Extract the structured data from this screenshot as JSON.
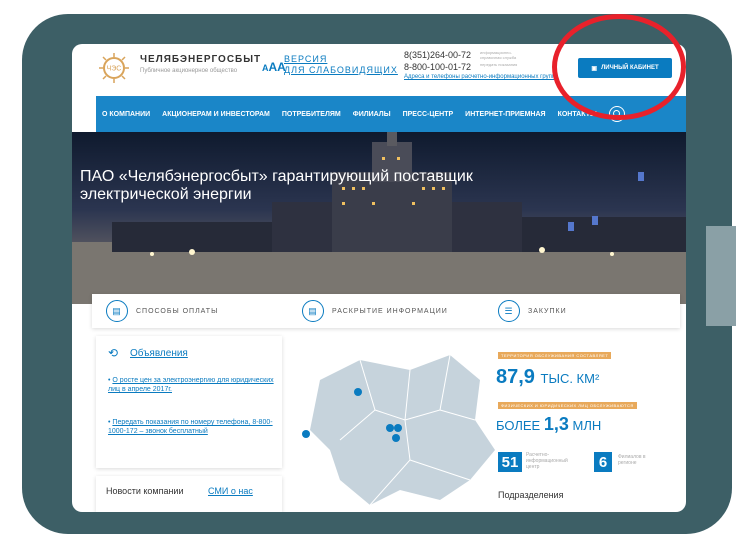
{
  "header": {
    "brand": "ЧЕЛЯБЭНЕРГОСБЫТ",
    "brand_sub": "Публичное акционерное общество",
    "logo_text": "ЧЭС",
    "font_size_toggle": "AA",
    "font_size_small": "A",
    "accessible_version": "ВЕРСИЯ",
    "accessible_version_2": "ДЛЯ СЛАБОВИДЯЩИХ",
    "phone_1": "8(351)264-00-72",
    "phone_1_note": "информационно-справочная служба",
    "phone_2": "8-800-100-01-72",
    "phone_2_note": "передать показания",
    "addresses_link": "Адреса и телефоны расчетно-информационных групп",
    "cabinet_button": "ЛИЧНЫЙ КАБИНЕТ"
  },
  "nav": {
    "items": [
      "О КОМПАНИИ",
      "АКЦИОНЕРАМ И ИНВЕСТОРАМ",
      "ПОТРЕБИТЕЛЯМ",
      "ФИЛИАЛЫ",
      "ПРЕСС-ЦЕНТР",
      "ИНТЕРНЕТ-ПРИЕМНАЯ",
      "КОНТАКТЫ"
    ]
  },
  "hero": {
    "title": "ПАО «Челябэнергосбыт» гарантирующий поставщик электрической энергии"
  },
  "quick_links": {
    "items": [
      "СПОСОБЫ ОПЛАТЫ",
      "РАСКРЫТИЕ ИНФОРМАЦИИ",
      "ЗАКУПКИ"
    ]
  },
  "announcements": {
    "title": "Объявления",
    "items": [
      "О росте цен за электроэнергию для юридических лиц в апреле 2017г.",
      "Передать показания по номеру телефона, 8-800-1000-172 – звонок бесплатный"
    ]
  },
  "news": {
    "company_news": "Новости компании",
    "media": "СМИ о нас"
  },
  "stats": {
    "territory_label": "ТЕРРИТОРИЯ ОБСЛУЖИВАНИЯ СОСТАВЛЯЕТ",
    "territory_value": "87,9",
    "territory_unit": "ТЫС. КМ²",
    "customers_label": "ФИЗИЧЕСКИХ И ЮРИДИЧЕСКИХ ЛИЦ ОБСЛУЖИВАЮТСЯ",
    "customers_prefix": "БОЛЕЕ",
    "customers_value": "1,3",
    "customers_unit": "МЛН",
    "centers_value": "51",
    "centers_label": "Расчетно-информационный центр",
    "branches_value": "6",
    "branches_label": "Филиалов в регионе",
    "subdivisions": "Подразделения"
  },
  "colors": {
    "accent": "#0a7bc0",
    "nav": "#1a86c8",
    "tablet": "#3d5f66",
    "highlight": "#e8212b",
    "tag": "#e8a95b"
  }
}
